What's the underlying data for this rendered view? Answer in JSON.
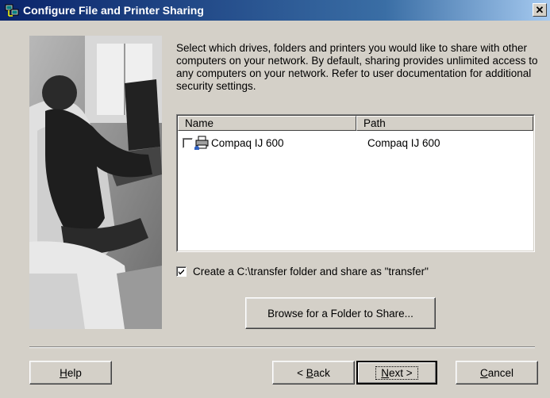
{
  "window": {
    "title": "Configure File and Printer Sharing",
    "close_glyph": "✕"
  },
  "description": "Select which drives, folders and printers you would like to share with other computers on your network. By default, sharing provides unlimited access to any computers on your network. Refer to user documentation for additional security settings.",
  "list": {
    "columns": {
      "name": "Name",
      "path": "Path"
    },
    "rows": [
      {
        "checked": false,
        "icon": "shared-printer-icon",
        "name": "Compaq IJ 600",
        "path": "Compaq IJ 600"
      }
    ]
  },
  "transfer": {
    "checked": true,
    "label": "Create a C:\\transfer folder and share as \"transfer\""
  },
  "browse_button": "Browse for a Folder to Share...",
  "buttons": {
    "help_accel": "H",
    "help_rest": "elp",
    "back_prefix": "< ",
    "back_accel": "B",
    "back_rest": "ack",
    "next_accel": "N",
    "next_rest": "ext >",
    "cancel_accel": "C",
    "cancel_rest": "ancel"
  }
}
